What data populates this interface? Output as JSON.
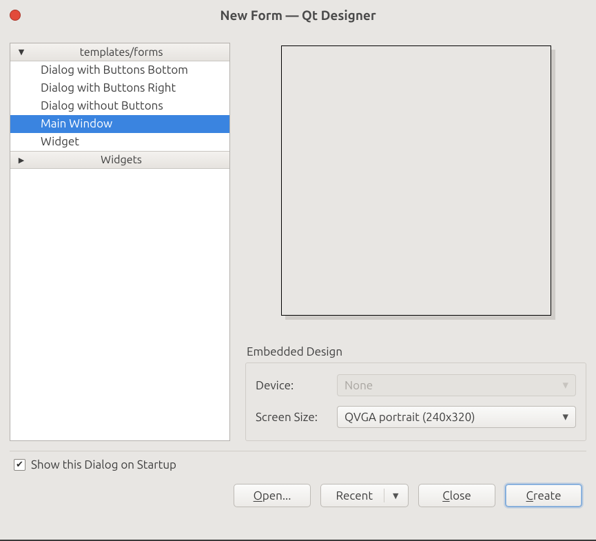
{
  "window": {
    "title": "New Form — Qt Designer"
  },
  "tree": {
    "groups": [
      {
        "label": "templates/forms",
        "expanded": true,
        "items": [
          {
            "label": "Dialog with Buttons Bottom",
            "selected": false
          },
          {
            "label": "Dialog with Buttons Right",
            "selected": false
          },
          {
            "label": "Dialog without Buttons",
            "selected": false
          },
          {
            "label": "Main Window",
            "selected": true
          },
          {
            "label": "Widget",
            "selected": false
          }
        ]
      },
      {
        "label": "Widgets",
        "expanded": false,
        "items": []
      }
    ]
  },
  "embedded": {
    "group_label": "Embedded Design",
    "device_label": "Device:",
    "device_value": "None",
    "screen_label": "Screen Size:",
    "screen_value": "QVGA portrait (240x320)"
  },
  "startup": {
    "checked": true,
    "label": "Show this Dialog on Startup"
  },
  "buttons": {
    "open": "Open...",
    "recent": "Recent",
    "close": "Close",
    "create": "Create"
  },
  "mnemonics": {
    "open_u": "O",
    "close_u": "C",
    "create_u": "C"
  }
}
